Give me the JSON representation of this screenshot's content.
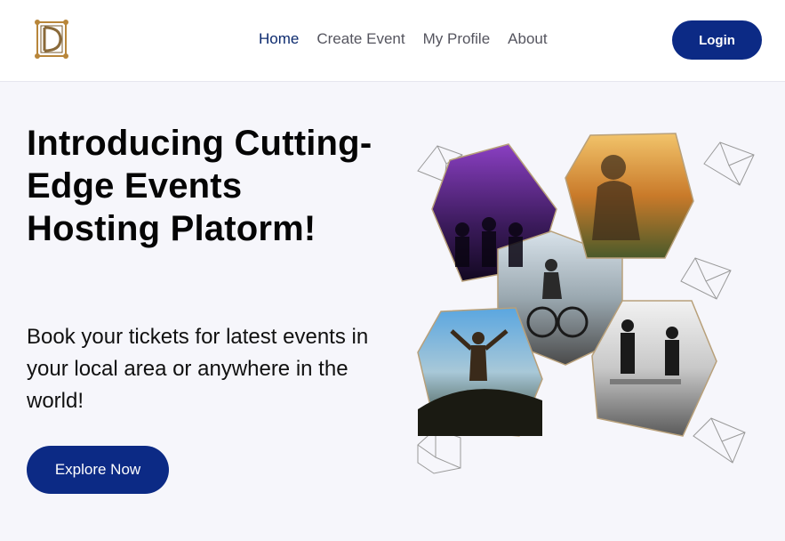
{
  "nav": {
    "links": [
      {
        "label": "Home",
        "active": true
      },
      {
        "label": "Create Event",
        "active": false
      },
      {
        "label": "My Profile",
        "active": false
      },
      {
        "label": "About",
        "active": false
      }
    ],
    "login_label": "Login"
  },
  "hero": {
    "title": "Introducing Cutting-Edge Events Hosting Platorm!",
    "subtitle": "Book your tickets for latest events in your local area or anywhere in the world!",
    "cta_label": "Explore Now"
  },
  "colors": {
    "primary": "#0c2a85",
    "nav_active": "#0c2a6e",
    "page_bg": "#f6f6fb",
    "logo_gold": "#b8863a"
  },
  "icons": {
    "logo": "ornate-d-monogram",
    "collage": "hexagon-photo-cubes"
  }
}
